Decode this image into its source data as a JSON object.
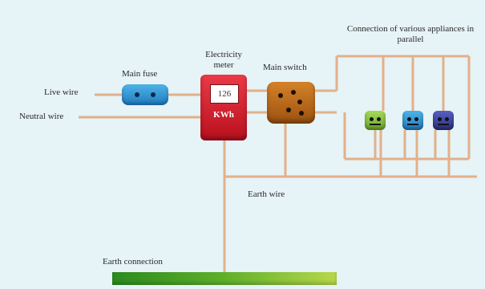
{
  "labels": {
    "live_wire": "Live wire",
    "neutral_wire": "Neutral wire",
    "main_fuse": "Main fuse",
    "electricity_meter": "Electricity meter",
    "main_switch": "Main switch",
    "connection": "Connection of various appliances in parallel",
    "earth_wire": "Earth wire",
    "earth_connection": "Earth connection"
  },
  "meter": {
    "window_text": "126",
    "reading": "KWh"
  },
  "colors": {
    "background": "#e6f3f7",
    "wire": "#e3b08a",
    "fuse": "#2a8fd4",
    "meter": "#d71f2d",
    "main_switch": "#c06e1c",
    "appliance_1": "#8cc63f",
    "appliance_2": "#2a8fd4",
    "appliance_3": "#3a3f9e",
    "earth_plate": "#5fb02a"
  },
  "icons": [
    "fuse-icon",
    "meter-icon",
    "switch-icon",
    "socket-icon"
  ]
}
